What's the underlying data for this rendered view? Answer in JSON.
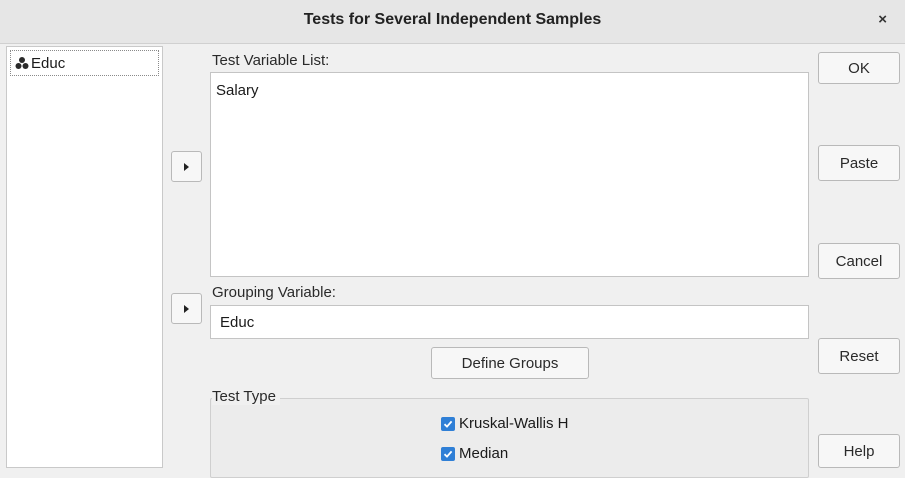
{
  "window": {
    "title": "Tests for Several Independent Samples",
    "close_glyph": "×"
  },
  "source_list": {
    "items": [
      {
        "label": "Educ",
        "icon": "nominal-variable-icon"
      }
    ]
  },
  "test_variable": {
    "label": "Test Variable List:",
    "items": [
      "Salary"
    ],
    "move_button_icon": "right-arrow-icon"
  },
  "grouping_variable": {
    "label": "Grouping Variable:",
    "value": "Educ",
    "move_button_icon": "right-arrow-icon",
    "define_groups_label": "Define Groups"
  },
  "test_type": {
    "legend": "Test Type",
    "options": [
      {
        "label": "Kruskal-Wallis H",
        "checked": true
      },
      {
        "label": "Median",
        "checked": true
      }
    ]
  },
  "buttons": {
    "ok": "OK",
    "paste": "Paste",
    "cancel": "Cancel",
    "reset": "Reset",
    "help": "Help"
  },
  "colors": {
    "checkbox_accent": "#2f7fd6",
    "title_bar": "#e6e6e6",
    "dialog_bg": "#f0f0f0"
  }
}
